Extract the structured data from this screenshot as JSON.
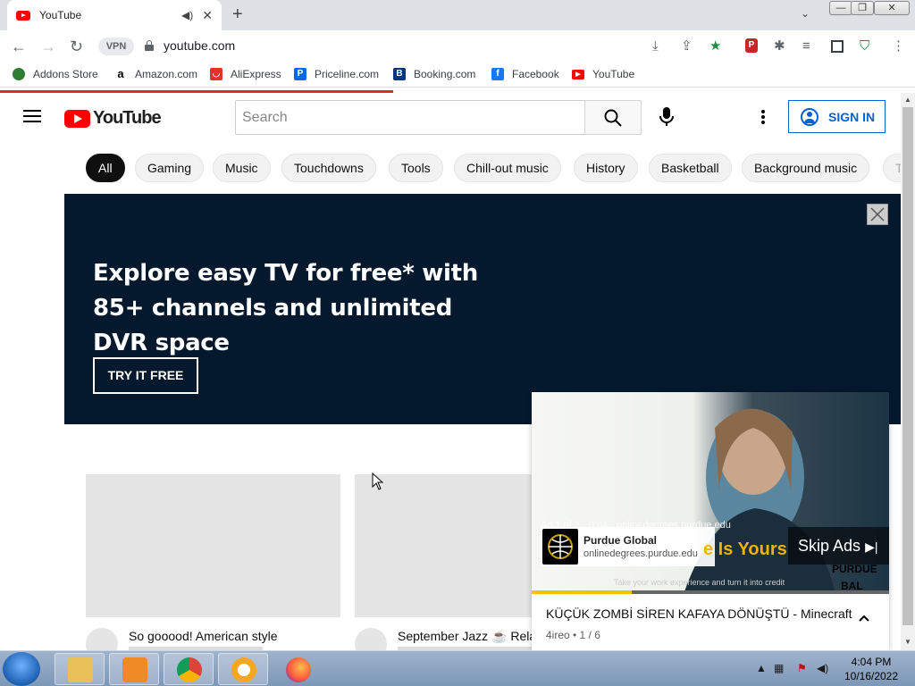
{
  "browser": {
    "tab_title": "YouTube",
    "url": "youtube.com",
    "vpn_label": "VPN",
    "bookmarks": [
      {
        "label": "Addons Store",
        "color": "#2e7d32"
      },
      {
        "label": "Amazon.com",
        "color": "#000000"
      },
      {
        "label": "AliExpress",
        "color": "#e43225"
      },
      {
        "label": "Priceline.com",
        "color": "#0068ef"
      },
      {
        "label": "Booking.com",
        "color": "#003580"
      },
      {
        "label": "Facebook",
        "color": "#1877f2"
      },
      {
        "label": "YouTube",
        "color": "#ff0000"
      }
    ],
    "page_load_progress": 0.43
  },
  "youtube": {
    "logo_text": "YouTube",
    "search_placeholder": "Search",
    "signin_label": "SIGN IN",
    "chips": [
      "All",
      "Gaming",
      "Music",
      "Touchdowns",
      "Tools",
      "Chill-out music",
      "History",
      "Basketball",
      "Background music",
      "T"
    ],
    "banner": {
      "headline": "Explore easy TV for free* with 85+ channels and unlimited DVR space",
      "cta": "TRY IT FREE"
    },
    "videos": [
      {
        "title": "So gooood! American style"
      },
      {
        "title": "September Jazz ☕ Relax"
      }
    ]
  },
  "mini_player": {
    "ad_info": "Ad 1 of 2 · 0:04 · onlinedegrees.purdue.edu",
    "advertiser": "Purdue Global",
    "advertiser_url": "onlinedegrees.purdue.edu",
    "overlay_text": "e Is Yours",
    "caption": "Take your work experience and turn it into credit",
    "brand_text": "PURDUE",
    "brand_sub": "BAL",
    "skip_label": "Skip Ads",
    "ad_progress": 0.28,
    "title": "KÜÇÜK ZOMBİ SİREN KAFAYA DÖNÜŞTÜ - Minecraft",
    "subtitle": "4ireo • 1 / 6"
  },
  "taskbar": {
    "time": "4:04 PM",
    "date": "10/16/2022"
  }
}
